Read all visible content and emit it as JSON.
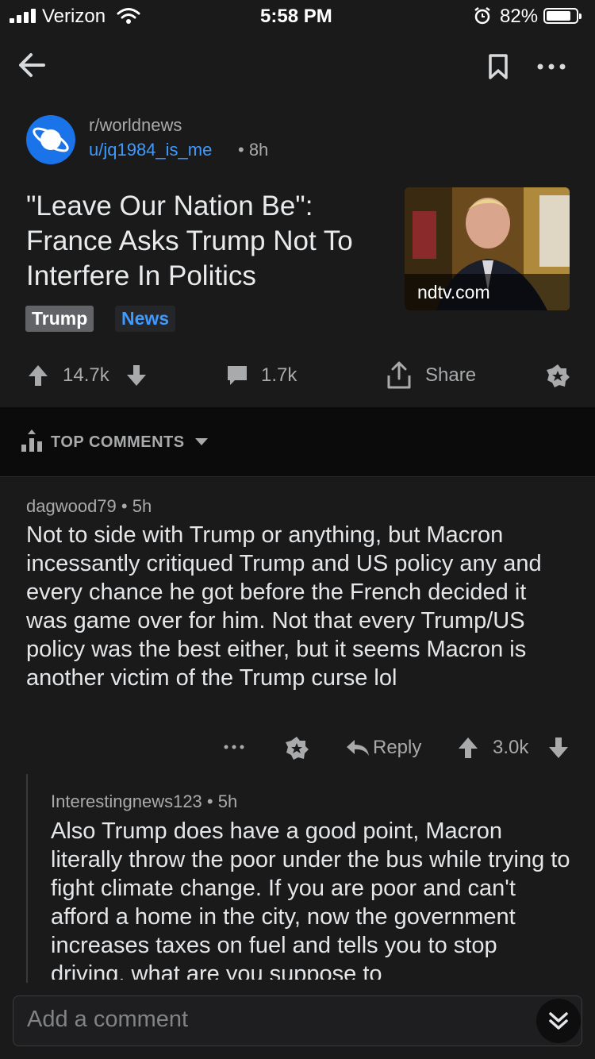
{
  "status_bar": {
    "carrier": "Verizon",
    "time": "5:58 PM",
    "battery_percent": "82%",
    "battery_level": 0.82,
    "signal_bars": 4,
    "icons": [
      "signal-icon",
      "wifi-icon",
      "alarm-icon",
      "battery-icon"
    ]
  },
  "header": {
    "icons": [
      "back-arrow-icon",
      "bookmark-icon",
      "more-options-icon"
    ]
  },
  "post": {
    "subreddit": "r/worldnews",
    "author": "u/jq1984_is_me",
    "age": "• 8h",
    "title": "\"Leave Our Nation Be\": France Asks Trump Not To Interfere In Politics",
    "thumbnail_domain": "ndtv.com",
    "flairs": [
      "Trump",
      "News"
    ],
    "upvotes": "14.7k",
    "comments_count": "1.7k",
    "share_label": "Share",
    "colors": {
      "link": "#3d9aff",
      "subreddit_icon": "#1a73e8"
    }
  },
  "comments_sort": {
    "label": "TOP COMMENTS"
  },
  "comments": [
    {
      "author": "dagwood79",
      "age": "• 5h",
      "body": "Not to side with Trump or anything, but Macron incessantly critiqued Trump and US policy any and every chance he got before the French decided it was game over for him. Not that every Trump/US policy was the best either, but it seems Macron is another victim of the Trump curse lol",
      "reply_label": "Reply",
      "score": "3.0k"
    },
    {
      "author": "Interestingnews123",
      "age": "• 5h",
      "body": "Also Trump does have a good point, Macron literally throw the poor under the bus while trying to fight climate change. If you are poor and can't afford a home in the city, now the government increases taxes on fuel and tells you to stop driving. what are you suppose to"
    }
  ],
  "composer": {
    "placeholder": "Add a comment"
  }
}
